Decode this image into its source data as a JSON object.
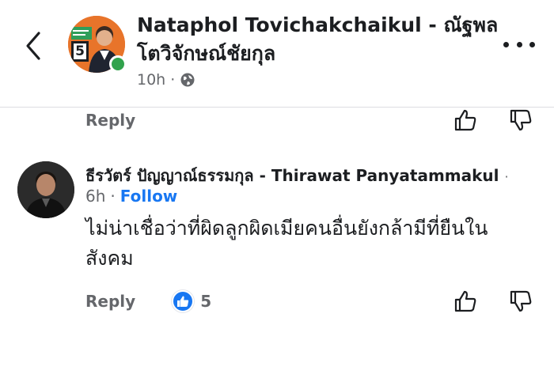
{
  "post_header": {
    "author_name": "Nataphol Tovichakchaikul - ณัฐพล โตวิจักษณ์ชัยกุล",
    "avatar_badge_number": "5",
    "time": "10h",
    "separator": "·",
    "audience_icon": "globe-icon"
  },
  "previous_comment": {
    "reply_label": "Reply"
  },
  "comment": {
    "author": "ธีรวัตร์ ปัญญาณ์ธรรมกุล - Thirawat Panyatammakul",
    "time": "6h",
    "separator": "·",
    "follow_label": "Follow",
    "text": "ไม่น่าเชื่อว่าที่ผิดลูกผิดเมียคนอื่นยังกล้ามีที่ยืนในสังคม",
    "reply_label": "Reply",
    "like_count": "5"
  },
  "colors": {
    "accent": "#1877f2",
    "muted_text": "#65676b",
    "online": "#31a24c",
    "avatar_orange": "#e8742a"
  }
}
